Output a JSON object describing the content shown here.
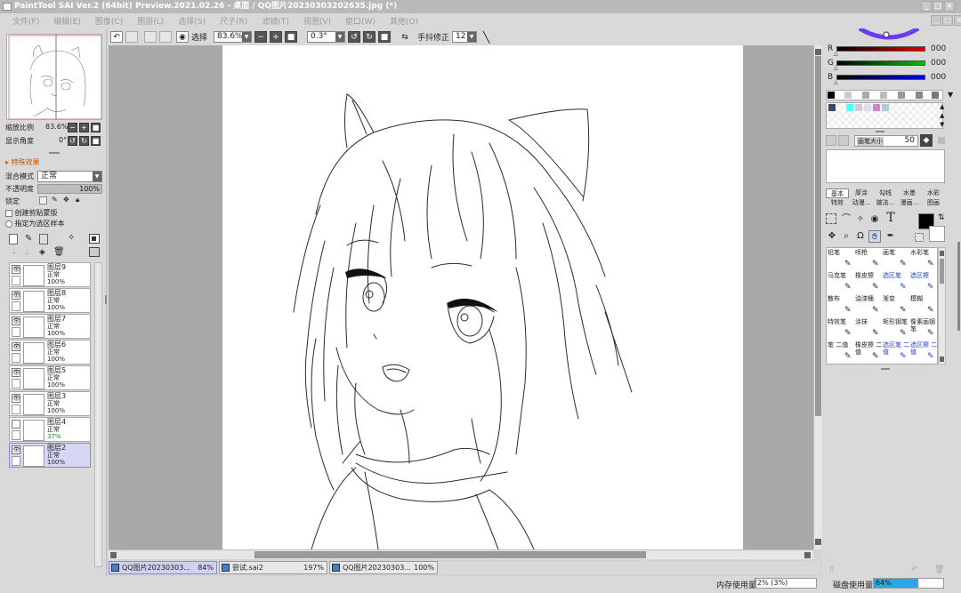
{
  "window": {
    "title": "PaintTool SAI Ver.2 (64bit) Preview.2021.02.26 - 桌面 / QQ图片20230303202635.jpg (*)"
  },
  "menu": [
    "文件(F)",
    "编辑(E)",
    "图像(C)",
    "图层(L)",
    "选择(S)",
    "尺子(R)",
    "滤镜(T)",
    "视图(V)",
    "窗口(W)",
    "其他(O)"
  ],
  "toolbar": {
    "select_label": "选择",
    "zoom": "83.6%",
    "angle": "0.3°",
    "stabilizer_label": "手抖修正",
    "stabilizer_value": "12"
  },
  "navigator": {
    "zoom_label": "缩放比例",
    "zoom_value": "83.6%",
    "angle_label": "显示角度",
    "angle_value": "0°"
  },
  "layer_panel": {
    "effects_label": "特殊效果",
    "blend_label": "混合模式",
    "blend_value": "正常",
    "opacity_label": "不透明度",
    "opacity_value": "100%",
    "lock_label": "锁定",
    "clip_label": "创建剪贴蒙版",
    "sample_label": "指定为选区样本",
    "layers": [
      {
        "name": "图层9",
        "mode": "正常",
        "opacity": "100%",
        "visible": true
      },
      {
        "name": "图层8",
        "mode": "正常",
        "opacity": "100%",
        "visible": true
      },
      {
        "name": "图层7",
        "mode": "正常",
        "opacity": "100%",
        "visible": true
      },
      {
        "name": "图层6",
        "mode": "正常",
        "opacity": "100%",
        "visible": true
      },
      {
        "name": "图层5",
        "mode": "正常",
        "opacity": "100%",
        "visible": true
      },
      {
        "name": "图层3",
        "mode": "正常",
        "opacity": "100%",
        "visible": true
      },
      {
        "name": "图层4",
        "mode": "正常",
        "opacity": "37%",
        "visible": false
      },
      {
        "name": "图层2",
        "mode": "正常",
        "opacity": "100%",
        "visible": true,
        "selected": true
      }
    ]
  },
  "color": {
    "r_label": "R",
    "g_label": "G",
    "b_label": "B",
    "r": "000",
    "g": "000",
    "b": "000"
  },
  "brush_size": {
    "label": "画笔大小",
    "value": "50"
  },
  "tool_tabs": [
    "基本",
    "厚涂",
    "勾线",
    "水墨",
    "水彩",
    "特效",
    "动漫...",
    "皴法...",
    "漫画...",
    "图画"
  ],
  "brushes": [
    {
      "name": "铅笔",
      "icon": "pencil-icon"
    },
    {
      "name": "喷枪",
      "icon": "airbrush-icon"
    },
    {
      "name": "画笔",
      "icon": "brush-icon"
    },
    {
      "name": "水彩笔",
      "icon": "watercolor-icon"
    },
    {
      "name": "马克笔",
      "icon": "marker-icon"
    },
    {
      "name": "橡皮擦",
      "icon": "eraser-icon"
    },
    {
      "name": "选区笔",
      "icon": "selpen-icon",
      "blue": true
    },
    {
      "name": "选区擦",
      "icon": "selerase-icon",
      "blue": true
    },
    {
      "name": "散布",
      "icon": "scatter-icon"
    },
    {
      "name": "油漆桶",
      "icon": "bucket-icon"
    },
    {
      "name": "渐变",
      "icon": "gradient-icon"
    },
    {
      "name": "模糊",
      "icon": "blur-icon"
    },
    {
      "name": "特效笔",
      "icon": "fxpen-icon"
    },
    {
      "name": "涂抹",
      "icon": "smudge-icon"
    },
    {
      "name": "矩形钢笔",
      "icon": "rectpen-icon"
    },
    {
      "name": "像素画钢笔",
      "icon": "pixelpen-icon"
    },
    {
      "name": "笔 二值",
      "icon": "binpen-icon"
    },
    {
      "name": "橡皮擦 二值",
      "icon": "binerase-icon"
    },
    {
      "name": "选区笔 二值",
      "icon": "binselpen-icon",
      "blue": true
    },
    {
      "name": "选区擦 二值",
      "icon": "binselerase-icon",
      "blue": true
    }
  ],
  "documents": [
    {
      "name": "QQ图片20230303...",
      "zoom": "84%",
      "active": true
    },
    {
      "name": "尝试.sai2",
      "zoom": "197%",
      "active": false
    },
    {
      "name": "QQ图片20230303...",
      "zoom": "100%",
      "active": false
    }
  ],
  "status": {
    "memory_label": "内存使用量",
    "memory_value": "2% (3%)",
    "memory_fraction": 0.02,
    "disk_label": "磁盘使用量",
    "disk_value": "64%",
    "disk_fraction": 0.64
  },
  "colors": {
    "accent_blue": "#2aa7e8",
    "selected_layer": "#d6d6f5",
    "red_slider": "#e00000",
    "green_slider": "#00c000",
    "blue_slider": "#0000e0"
  }
}
